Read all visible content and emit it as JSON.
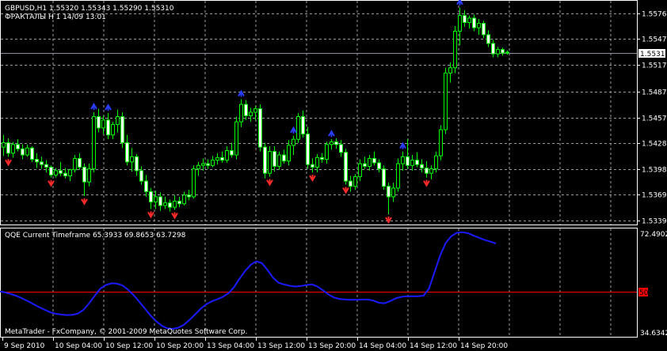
{
  "header": {
    "symbol_line": "GBPUSD,H1  1.55320 1.55343 1.55290 1.55310",
    "indicator_line": "ФРАКТАЛЫ  H 1    14/09 13:01"
  },
  "indicator_label": "QQE Current Timeframe 65.3933 69.8653 63.7298",
  "watermark": "MetaTrader - FxCompany, © 2001-2009 MetaQuotes Software Corp.",
  "price_axis": {
    "labels": [
      "1.55760",
      "1.55470",
      "1.55170",
      "1.54870",
      "1.54570",
      "1.54280",
      "1.53980",
      "1.53690",
      "1.53390"
    ],
    "current_price": "1.55310"
  },
  "qqe_axis": {
    "top": "72.4902",
    "level": "50",
    "bottom": "34.6342"
  },
  "time_axis": [
    "9 Sep 2010",
    "10 Sep 04:00",
    "10 Sep 12:00",
    "10 Sep 20:00",
    "13 Sep 04:00",
    "13 Sep 12:00",
    "13 Sep 20:00",
    "14 Sep 04:00",
    "14 Sep 12:00",
    "14 Sep 20:00"
  ],
  "colors": {
    "background": "#000000",
    "grid": "#9a9a9a",
    "bull_candle": "#000000",
    "bear_candle": "#ffffff",
    "wick": "#00ff00",
    "fractal_up": "#2a3cff",
    "fractal_down": "#ff2a2a",
    "qqe_line": "#1a1aff",
    "qqe_level": "#ff0000",
    "current_price_line": "#8c8c9c"
  },
  "chart_data": {
    "type": "candlestick",
    "symbol": "GBPUSD",
    "timeframe": "H1",
    "price_range": [
      1.5336,
      1.559
    ],
    "candles": [
      {
        "o": 1.5423,
        "h": 1.5437,
        "l": 1.5413,
        "c": 1.5428
      },
      {
        "o": 1.5428,
        "h": 1.5433,
        "l": 1.5412,
        "c": 1.5416
      },
      {
        "o": 1.5416,
        "h": 1.5429,
        "l": 1.5411,
        "c": 1.5426
      },
      {
        "o": 1.5426,
        "h": 1.5432,
        "l": 1.5418,
        "c": 1.5421
      },
      {
        "o": 1.5421,
        "h": 1.5426,
        "l": 1.5409,
        "c": 1.5414
      },
      {
        "o": 1.5414,
        "h": 1.5426,
        "l": 1.5412,
        "c": 1.5422
      },
      {
        "o": 1.5422,
        "h": 1.5424,
        "l": 1.5406,
        "c": 1.5409
      },
      {
        "o": 1.5409,
        "h": 1.5416,
        "l": 1.5399,
        "c": 1.5406
      },
      {
        "o": 1.5406,
        "h": 1.5412,
        "l": 1.5398,
        "c": 1.5403
      },
      {
        "o": 1.5403,
        "h": 1.5408,
        "l": 1.5394,
        "c": 1.54
      },
      {
        "o": 1.54,
        "h": 1.5402,
        "l": 1.5388,
        "c": 1.5391
      },
      {
        "o": 1.5391,
        "h": 1.5399,
        "l": 1.5388,
        "c": 1.5396
      },
      {
        "o": 1.5396,
        "h": 1.5406,
        "l": 1.539,
        "c": 1.5393
      },
      {
        "o": 1.5393,
        "h": 1.5399,
        "l": 1.5387,
        "c": 1.539
      },
      {
        "o": 1.539,
        "h": 1.5398,
        "l": 1.5384,
        "c": 1.5397
      },
      {
        "o": 1.5397,
        "h": 1.5414,
        "l": 1.5394,
        "c": 1.541
      },
      {
        "o": 1.541,
        "h": 1.5416,
        "l": 1.5397,
        "c": 1.54
      },
      {
        "o": 1.54,
        "h": 1.5404,
        "l": 1.5367,
        "c": 1.5383
      },
      {
        "o": 1.5383,
        "h": 1.5404,
        "l": 1.5378,
        "c": 1.5398
      },
      {
        "o": 1.5398,
        "h": 1.5463,
        "l": 1.5394,
        "c": 1.5458
      },
      {
        "o": 1.5458,
        "h": 1.5467,
        "l": 1.544,
        "c": 1.5445
      },
      {
        "o": 1.5445,
        "h": 1.5459,
        "l": 1.5438,
        "c": 1.5454
      },
      {
        "o": 1.5454,
        "h": 1.5462,
        "l": 1.5432,
        "c": 1.5437
      },
      {
        "o": 1.5437,
        "h": 1.5452,
        "l": 1.5432,
        "c": 1.5449
      },
      {
        "o": 1.5449,
        "h": 1.5466,
        "l": 1.544,
        "c": 1.5458
      },
      {
        "o": 1.5458,
        "h": 1.5463,
        "l": 1.5422,
        "c": 1.5428
      },
      {
        "o": 1.5428,
        "h": 1.5437,
        "l": 1.5402,
        "c": 1.5406
      },
      {
        "o": 1.5406,
        "h": 1.5422,
        "l": 1.5395,
        "c": 1.5412
      },
      {
        "o": 1.5412,
        "h": 1.5415,
        "l": 1.539,
        "c": 1.5396
      },
      {
        "o": 1.5396,
        "h": 1.5401,
        "l": 1.538,
        "c": 1.5384
      },
      {
        "o": 1.5384,
        "h": 1.5391,
        "l": 1.5366,
        "c": 1.5372
      },
      {
        "o": 1.5372,
        "h": 1.5376,
        "l": 1.5352,
        "c": 1.536
      },
      {
        "o": 1.536,
        "h": 1.5373,
        "l": 1.5352,
        "c": 1.5366
      },
      {
        "o": 1.5366,
        "h": 1.5371,
        "l": 1.535,
        "c": 1.5356
      },
      {
        "o": 1.5356,
        "h": 1.5366,
        "l": 1.5352,
        "c": 1.5359
      },
      {
        "o": 1.5359,
        "h": 1.5363,
        "l": 1.5349,
        "c": 1.5354
      },
      {
        "o": 1.5354,
        "h": 1.5368,
        "l": 1.5351,
        "c": 1.5361
      },
      {
        "o": 1.5361,
        "h": 1.5366,
        "l": 1.5354,
        "c": 1.5358
      },
      {
        "o": 1.5358,
        "h": 1.5372,
        "l": 1.5356,
        "c": 1.5368
      },
      {
        "o": 1.5368,
        "h": 1.5374,
        "l": 1.5362,
        "c": 1.5366
      },
      {
        "o": 1.5366,
        "h": 1.5402,
        "l": 1.5364,
        "c": 1.5398
      },
      {
        "o": 1.5398,
        "h": 1.5406,
        "l": 1.539,
        "c": 1.5402
      },
      {
        "o": 1.5402,
        "h": 1.541,
        "l": 1.5396,
        "c": 1.5404
      },
      {
        "o": 1.5404,
        "h": 1.5409,
        "l": 1.5398,
        "c": 1.5402
      },
      {
        "o": 1.5402,
        "h": 1.5413,
        "l": 1.54,
        "c": 1.5408
      },
      {
        "o": 1.5408,
        "h": 1.5416,
        "l": 1.5403,
        "c": 1.5411
      },
      {
        "o": 1.5411,
        "h": 1.5418,
        "l": 1.5405,
        "c": 1.5408
      },
      {
        "o": 1.5408,
        "h": 1.5424,
        "l": 1.5405,
        "c": 1.5419
      },
      {
        "o": 1.5419,
        "h": 1.5428,
        "l": 1.5411,
        "c": 1.5414
      },
      {
        "o": 1.5414,
        "h": 1.5458,
        "l": 1.5409,
        "c": 1.5452
      },
      {
        "o": 1.5452,
        "h": 1.5478,
        "l": 1.5446,
        "c": 1.5472
      },
      {
        "o": 1.5472,
        "h": 1.5477,
        "l": 1.5454,
        "c": 1.5459
      },
      {
        "o": 1.5459,
        "h": 1.5468,
        "l": 1.5452,
        "c": 1.5463
      },
      {
        "o": 1.5463,
        "h": 1.547,
        "l": 1.5454,
        "c": 1.5467
      },
      {
        "o": 1.5467,
        "h": 1.5472,
        "l": 1.5418,
        "c": 1.5423
      },
      {
        "o": 1.5423,
        "h": 1.5428,
        "l": 1.5387,
        "c": 1.5393
      },
      {
        "o": 1.5393,
        "h": 1.5424,
        "l": 1.5389,
        "c": 1.5418
      },
      {
        "o": 1.5418,
        "h": 1.5424,
        "l": 1.5395,
        "c": 1.5401
      },
      {
        "o": 1.5401,
        "h": 1.5418,
        "l": 1.5397,
        "c": 1.5414
      },
      {
        "o": 1.5414,
        "h": 1.542,
        "l": 1.5404,
        "c": 1.5407
      },
      {
        "o": 1.5407,
        "h": 1.5431,
        "l": 1.5402,
        "c": 1.5425
      },
      {
        "o": 1.5425,
        "h": 1.5436,
        "l": 1.5414,
        "c": 1.5432
      },
      {
        "o": 1.5432,
        "h": 1.5462,
        "l": 1.5428,
        "c": 1.5458
      },
      {
        "o": 1.5458,
        "h": 1.5465,
        "l": 1.5434,
        "c": 1.5438
      },
      {
        "o": 1.5438,
        "h": 1.5446,
        "l": 1.5398,
        "c": 1.5403
      },
      {
        "o": 1.5403,
        "h": 1.541,
        "l": 1.5394,
        "c": 1.54
      },
      {
        "o": 1.54,
        "h": 1.5415,
        "l": 1.5394,
        "c": 1.5411
      },
      {
        "o": 1.5411,
        "h": 1.5416,
        "l": 1.5405,
        "c": 1.5409
      },
      {
        "o": 1.5409,
        "h": 1.5429,
        "l": 1.5404,
        "c": 1.5426
      },
      {
        "o": 1.5426,
        "h": 1.5432,
        "l": 1.542,
        "c": 1.5429
      },
      {
        "o": 1.5429,
        "h": 1.5433,
        "l": 1.5421,
        "c": 1.5426
      },
      {
        "o": 1.5426,
        "h": 1.5431,
        "l": 1.5412,
        "c": 1.5417
      },
      {
        "o": 1.5417,
        "h": 1.5421,
        "l": 1.538,
        "c": 1.5384
      },
      {
        "o": 1.5384,
        "h": 1.539,
        "l": 1.5372,
        "c": 1.5378
      },
      {
        "o": 1.5378,
        "h": 1.5392,
        "l": 1.5374,
        "c": 1.5389
      },
      {
        "o": 1.5389,
        "h": 1.5409,
        "l": 1.5384,
        "c": 1.5404
      },
      {
        "o": 1.5404,
        "h": 1.5412,
        "l": 1.5398,
        "c": 1.5401
      },
      {
        "o": 1.5401,
        "h": 1.5414,
        "l": 1.5396,
        "c": 1.541
      },
      {
        "o": 1.541,
        "h": 1.5418,
        "l": 1.5402,
        "c": 1.5405
      },
      {
        "o": 1.5405,
        "h": 1.5409,
        "l": 1.5394,
        "c": 1.5398
      },
      {
        "o": 1.5398,
        "h": 1.5402,
        "l": 1.5374,
        "c": 1.5378
      },
      {
        "o": 1.5378,
        "h": 1.5382,
        "l": 1.5346,
        "c": 1.5366
      },
      {
        "o": 1.5366,
        "h": 1.5382,
        "l": 1.536,
        "c": 1.5376
      },
      {
        "o": 1.5376,
        "h": 1.541,
        "l": 1.5372,
        "c": 1.5404
      },
      {
        "o": 1.5404,
        "h": 1.5418,
        "l": 1.5396,
        "c": 1.5412
      },
      {
        "o": 1.5412,
        "h": 1.5432,
        "l": 1.5398,
        "c": 1.5402
      },
      {
        "o": 1.5402,
        "h": 1.5414,
        "l": 1.5396,
        "c": 1.5408
      },
      {
        "o": 1.5408,
        "h": 1.5417,
        "l": 1.54,
        "c": 1.5403
      },
      {
        "o": 1.5403,
        "h": 1.5409,
        "l": 1.5394,
        "c": 1.5399
      },
      {
        "o": 1.5399,
        "h": 1.5407,
        "l": 1.5388,
        "c": 1.5393
      },
      {
        "o": 1.5393,
        "h": 1.5402,
        "l": 1.5386,
        "c": 1.5398
      },
      {
        "o": 1.5398,
        "h": 1.5418,
        "l": 1.5394,
        "c": 1.5413
      },
      {
        "o": 1.5413,
        "h": 1.5448,
        "l": 1.5408,
        "c": 1.5443
      },
      {
        "o": 1.5443,
        "h": 1.5514,
        "l": 1.5438,
        "c": 1.5508
      },
      {
        "o": 1.5508,
        "h": 1.552,
        "l": 1.5497,
        "c": 1.5514
      },
      {
        "o": 1.5514,
        "h": 1.5562,
        "l": 1.5508,
        "c": 1.5556
      },
      {
        "o": 1.5556,
        "h": 1.5583,
        "l": 1.554,
        "c": 1.5574
      },
      {
        "o": 1.5574,
        "h": 1.558,
        "l": 1.5561,
        "c": 1.5566
      },
      {
        "o": 1.5566,
        "h": 1.5574,
        "l": 1.5559,
        "c": 1.5571
      },
      {
        "o": 1.5571,
        "h": 1.5575,
        "l": 1.5556,
        "c": 1.556
      },
      {
        "o": 1.556,
        "h": 1.557,
        "l": 1.5552,
        "c": 1.5565
      },
      {
        "o": 1.5565,
        "h": 1.5568,
        "l": 1.5548,
        "c": 1.5552
      },
      {
        "o": 1.5552,
        "h": 1.5557,
        "l": 1.5538,
        "c": 1.5542
      },
      {
        "o": 1.5542,
        "h": 1.5546,
        "l": 1.5526,
        "c": 1.553
      },
      {
        "o": 1.553,
        "h": 1.5538,
        "l": 1.5526,
        "c": 1.5535
      },
      {
        "o": 1.5535,
        "h": 1.5537,
        "l": 1.5528,
        "c": 1.5531
      },
      {
        "o": 1.5532,
        "h": 1.5534,
        "l": 1.5529,
        "c": 1.5531
      }
    ],
    "fractals_up": [
      19,
      22,
      50,
      61,
      69,
      84,
      96
    ],
    "fractals_down": [
      1,
      10,
      17,
      31,
      36,
      56,
      65,
      72,
      81,
      89
    ],
    "qqe": {
      "range": [
        34.6342,
        72.4902
      ],
      "level": 50,
      "values": [
        50.0,
        49.6,
        49.0,
        48.3,
        47.4,
        46.4,
        45.3,
        44.2,
        43.2,
        42.3,
        41.7,
        41.4,
        41.2,
        41.3,
        41.8,
        43.2,
        45.6,
        48.4,
        51.0,
        52.4,
        53.0,
        52.9,
        52.2,
        50.6,
        48.6,
        46.2,
        43.6,
        41.1,
        39.0,
        37.3,
        36.3,
        36.1,
        36.5,
        37.6,
        39.4,
        41.4,
        43.5,
        45.2,
        46.3,
        47.1,
        48.0,
        49.3,
        51.6,
        54.7,
        57.6,
        59.9,
        61.2,
        60.5,
        58.0,
        55.1,
        53.2,
        52.6,
        52.1,
        51.8,
        52.0,
        52.4,
        52.6,
        51.8,
        50.3,
        48.8,
        47.7,
        47.2,
        47.0,
        46.9,
        46.9,
        47.0,
        47.0,
        46.6,
        45.8,
        45.6,
        46.4,
        47.4,
        48.0,
        48.2,
        48.2,
        48.2,
        48.4,
        51.1,
        57.2,
        63.4,
        68.0,
        70.5,
        71.8,
        72.0,
        71.6,
        70.7,
        69.9,
        69.1,
        68.5,
        67.8
      ]
    }
  }
}
